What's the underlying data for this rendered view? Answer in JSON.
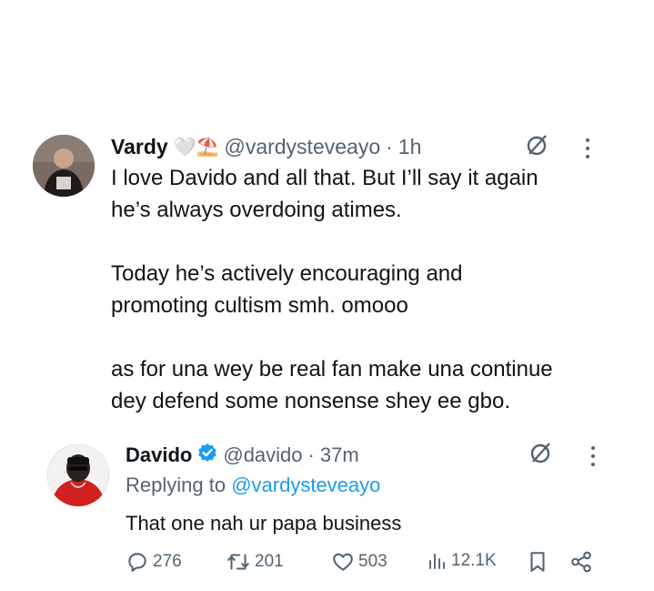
{
  "tweets": [
    {
      "name": "Vardy",
      "emojis": "🤍⛱️",
      "handle": "@vardysteveayo",
      "sep": "·",
      "time": "1h",
      "text": "I love Davido and all that. But I’ll say it again\nhe’s always overdoing atimes.\n\nToday he’s actively encouraging and\npromoting cultism smh. omooo\n\nas for una wey be real fan make una continue\ndey defend some nonsense shey ee gbo."
    },
    {
      "name": "Davido",
      "verified": true,
      "handle": "@davido",
      "sep": "·",
      "time": "37m",
      "replying_prefix": "Replying to",
      "replying_handle": "@vardysteveayo",
      "text": "That one  nah ur papa business"
    }
  ],
  "actions": {
    "replies": "276",
    "reposts": "201",
    "likes": "503",
    "views": "12.1K"
  },
  "colors": {
    "text": "#0f1419",
    "muted": "#536471",
    "accent": "#1d9bf0"
  },
  "icons": [
    "grok-icon",
    "more-icon",
    "verified-badge-icon",
    "reply-icon",
    "repost-icon",
    "like-icon",
    "views-icon",
    "bookmark-icon",
    "share-icon"
  ]
}
